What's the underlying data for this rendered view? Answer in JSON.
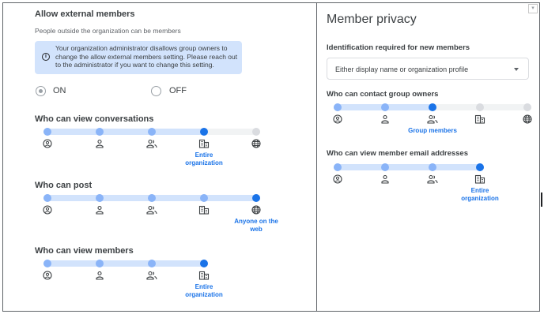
{
  "external": {
    "title": "Allow external members",
    "subtitle": "People outside the organization can be members",
    "info": "Your organization administrator disallows group owners to change the allow external members setting. Please reach out to the administrator if you want to change this setting.",
    "on_label": "ON",
    "off_label": "OFF",
    "selected": "ON"
  },
  "view_conversations": {
    "title": "Who can view conversations",
    "selected_label": "Entire organization",
    "level": 4,
    "max_level": 4
  },
  "post": {
    "title": "Who can post",
    "selected_label": "Anyone on the web",
    "level": 5,
    "max_level": 5
  },
  "view_members": {
    "title": "Who can view members",
    "selected_label": "Entire organization",
    "level": 4,
    "max_level": 4
  },
  "privacy": {
    "title": "Member privacy",
    "identification_label": "Identification required for new members",
    "identification_value": "Either display name or organization profile",
    "contact_owners": {
      "title": "Who can contact group owners",
      "selected_label": "Group members",
      "level": 3,
      "max_level": 3
    },
    "view_emails": {
      "title": "Who can view member email addresses",
      "selected_label": "Entire organization",
      "level": 4,
      "max_level": 4
    }
  },
  "level_icons": [
    "account-circle-icon",
    "person-icon",
    "group-icon",
    "domain-icon",
    "globe-icon"
  ],
  "colors": {
    "accent": "#1a73e8",
    "dot": "#8ab4f8",
    "fill": "#d2e3fc",
    "track": "#f1f3f4",
    "disabled": "#dadce0"
  }
}
